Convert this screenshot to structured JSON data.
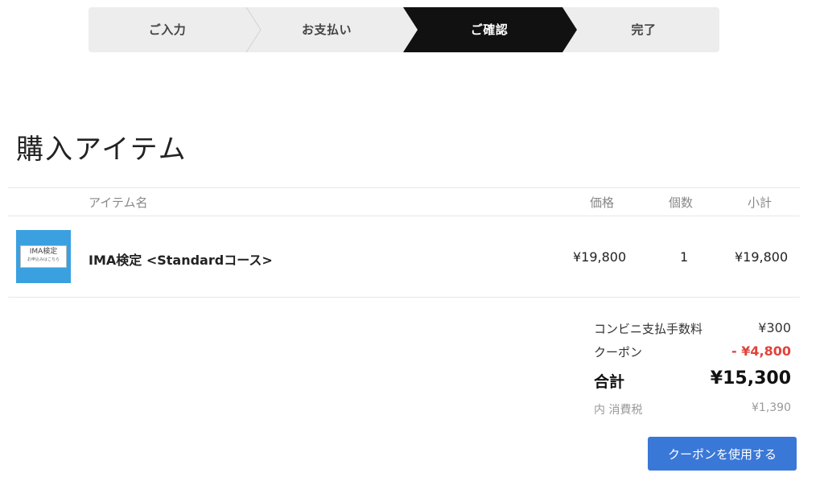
{
  "steps": [
    {
      "label": "ご入力",
      "active": false
    },
    {
      "label": "お支払い",
      "active": false
    },
    {
      "label": "ご確認",
      "active": true
    },
    {
      "label": "完了",
      "active": false
    }
  ],
  "page_title": "購入アイテム",
  "table": {
    "headers": {
      "item_name": "アイテム名",
      "price": "価格",
      "quantity": "個数",
      "subtotal": "小計"
    },
    "rows": [
      {
        "thumbnail": {
          "title": "IMA検定",
          "subtitle": "お申込みはこちら"
        },
        "name": "IMA検定 <Standardコース>",
        "price": "¥19,800",
        "quantity": "1",
        "subtotal": "¥19,800"
      }
    ]
  },
  "summary": {
    "fee_label": "コンビニ支払手数料",
    "fee_value": "¥300",
    "coupon_label": "クーポン",
    "coupon_value": "- ¥4,800",
    "total_label": "合計",
    "total_value": "¥15,300",
    "tax_label": "内 消費税",
    "tax_value": "¥1,390"
  },
  "buttons": {
    "use_coupon": "クーポンを使用する"
  },
  "colors": {
    "active_step": "#111111",
    "inactive_step": "#ededed",
    "coupon_discount": "#e0433b",
    "primary_button": "#3a78d8",
    "thumbnail_bg": "#3aa0e0"
  }
}
